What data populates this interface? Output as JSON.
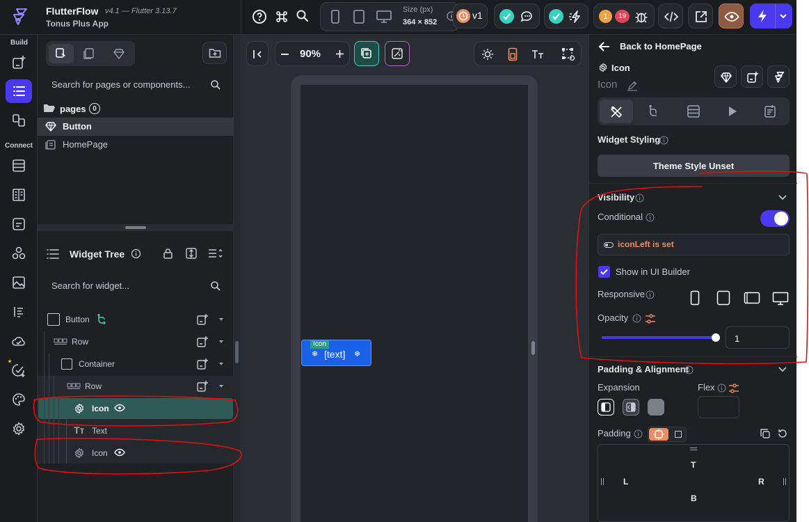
{
  "app": {
    "brand": "FlutterFlow",
    "version": "v4.1 — Flutter 3.13.7",
    "project": "Tonus Plus App"
  },
  "toolbar": {
    "size_label": "Size (px)",
    "size_value": "364 × 852",
    "version_badge": "v1",
    "issue_count_warn": "1",
    "issue_count_err": "19"
  },
  "rail": {
    "build_label": "Build",
    "connect_label": "Connect"
  },
  "pages_panel": {
    "search_placeholder": "Search for pages or components...",
    "folder_label": "pages",
    "folder_count": "0",
    "items": [
      "Button",
      "HomePage"
    ]
  },
  "widget_tree": {
    "title": "Widget Tree",
    "search_placeholder": "Search for widget...",
    "nodes": [
      {
        "label": "Button"
      },
      {
        "label": "Row"
      },
      {
        "label": "Container"
      },
      {
        "label": "Row"
      },
      {
        "label": "Icon"
      },
      {
        "label": "Text"
      },
      {
        "label": "Icon"
      }
    ]
  },
  "canvas": {
    "zoom": "90%",
    "widget_tag": "Icon",
    "widget_text": "[text]"
  },
  "properties": {
    "back_label": "Back to HomePage",
    "widget_type": "Icon",
    "widget_name": "Icon",
    "widget_styling_label": "Widget Styling",
    "theme_button": "Theme Style Unset",
    "visibility_label": "Visibility",
    "conditional_label": "Conditional",
    "conditional_on": true,
    "condition_text": "iconLeft is set",
    "show_in_ui_builder": "Show in UI Builder",
    "responsive_label": "Responsive",
    "opacity_label": "Opacity",
    "opacity_value": "1",
    "padding_alignment_label": "Padding & Alignment",
    "expansion_label": "Expansion",
    "flex_label": "Flex",
    "padding_label": "Padding",
    "pad_top": "T",
    "pad_left": "L",
    "pad_right": "R",
    "pad_bottom": "B"
  },
  "colors": {
    "accent": "#4b39ef",
    "teal": "#2f5b57",
    "orange": "#ee8b60",
    "annotation": "#e01010"
  }
}
